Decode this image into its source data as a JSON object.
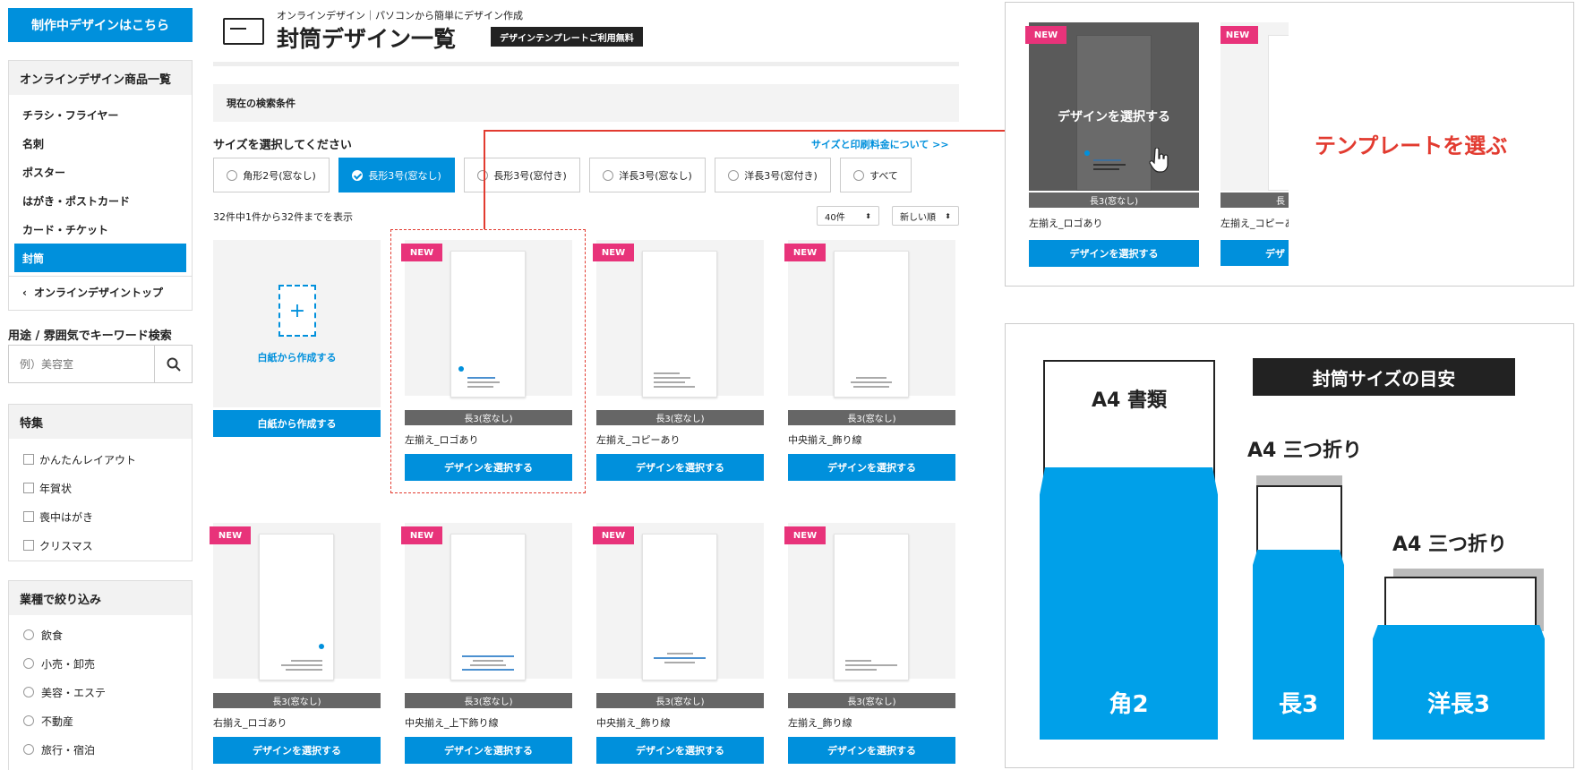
{
  "sidebar": {
    "cta": "制作中デザインはこちら",
    "products_title": "オンラインデザイン商品一覧",
    "products": [
      "チラシ・フライヤー",
      "名刺",
      "ポスター",
      "はがき・ポストカード",
      "カード・チケット",
      "封筒"
    ],
    "active_index": 5,
    "back": "オンラインデザイントップ",
    "search_title": "用途 / 雰囲気でキーワード検索",
    "search_placeholder": "例）美容室",
    "feature_title": "特集",
    "features": [
      "かんたんレイアウト",
      "年賀状",
      "喪中はがき",
      "クリスマス"
    ],
    "industry_title": "業種で絞り込み",
    "industries": [
      "飲食",
      "小売・卸売",
      "美容・エステ",
      "不動産",
      "旅行・宿泊"
    ]
  },
  "header": {
    "subtitle": "オンラインデザイン｜パソコンから簡単にデザイン作成",
    "title": "封筒デザイン一覧",
    "badge": "デザインテンプレートご利用無料"
  },
  "search_conditions": "現在の検索条件",
  "size_section": {
    "title": "サイズを選択してください",
    "link": "サイズと印刷料金について >>",
    "options": [
      "角形2号(窓なし)",
      "長形3号(窓なし)",
      "長形3号(窓付き)",
      "洋長3号(窓なし)",
      "洋長3号(窓付き)",
      "すべて"
    ],
    "selected_index": 1
  },
  "results": {
    "count_text": "32件中1件から32件までを表示",
    "per_page": "40件",
    "sort": "新しい順"
  },
  "blank_card": {
    "label": "白紙から作成する",
    "button": "白紙から作成する"
  },
  "cards": [
    {
      "tag": "NEW",
      "size": "長3(窓なし)",
      "name": "左揃え_ロゴあり",
      "button": "デザインを選択する"
    },
    {
      "tag": "NEW",
      "size": "長3(窓なし)",
      "name": "左揃え_コピーあり",
      "button": "デザインを選択する"
    },
    {
      "tag": "NEW",
      "size": "長3(窓なし)",
      "name": "中央揃え_飾り線",
      "button": "デザインを選択する"
    },
    {
      "tag": "NEW",
      "size": "長3(窓なし)",
      "name": "右揃え_ロゴあり",
      "button": "デザインを選択する"
    },
    {
      "tag": "NEW",
      "size": "長3(窓なし)",
      "name": "中央揃え_上下飾り線",
      "button": "デザインを選択する"
    },
    {
      "tag": "NEW",
      "size": "長3(窓なし)",
      "name": "中央揃え_飾り線",
      "button": "デザインを選択する"
    },
    {
      "tag": "NEW",
      "size": "長3(窓なし)",
      "name": "左揃え_飾り線",
      "button": "デザインを選択する"
    }
  ],
  "zoom": {
    "tag": "NEW",
    "overlay": "デザインを選択する",
    "size": "長3(窓なし)",
    "name": "左揃え_ロゴあり",
    "button": "デザインを選択する",
    "tag2": "NEW",
    "size2": "長",
    "name2": "左揃え_コピーあ",
    "button2": "デザ",
    "callout": "テンプレートを選ぶ"
  },
  "guide": {
    "title": "封筒サイズの目安",
    "kaku2_doc": "A4 書類",
    "kaku2": "角2",
    "naga3_doc": "A4 三つ折り",
    "naga3": "長3",
    "yonaga3_doc": "A4 三つ折り",
    "yonaga3": "洋長3"
  },
  "colors": {
    "accent": "#0090dc",
    "new_tag": "#e8337a",
    "callout": "#e23b30",
    "dark": "#222222"
  }
}
